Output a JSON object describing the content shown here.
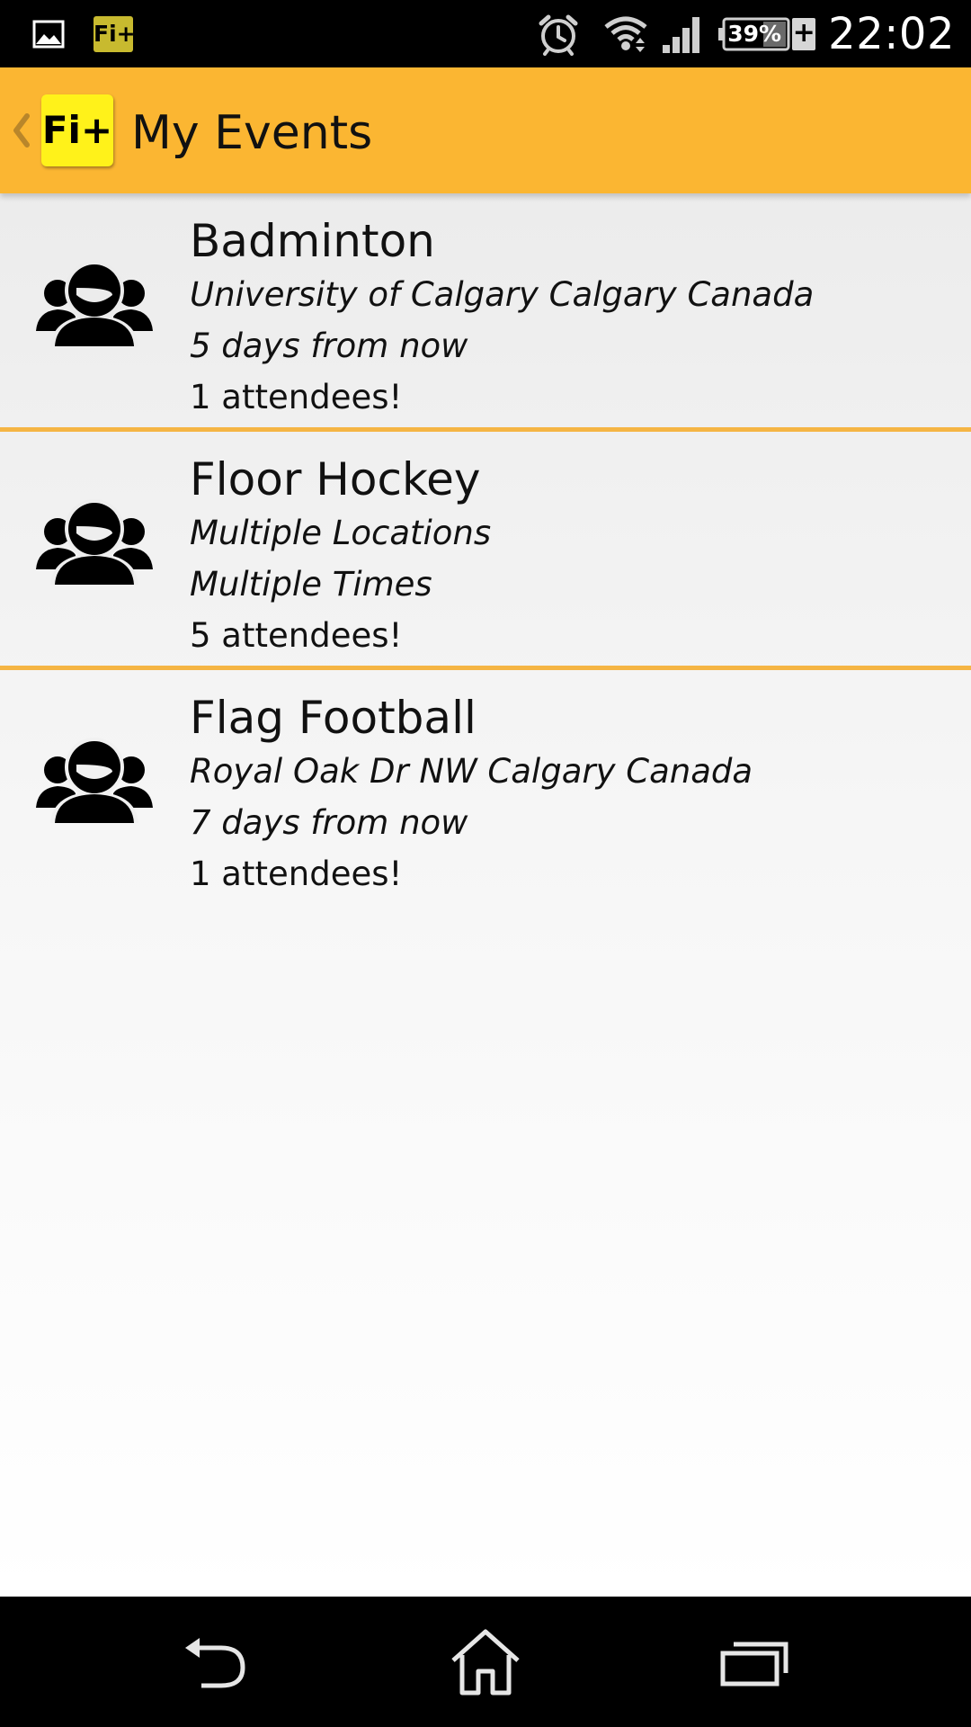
{
  "status_bar": {
    "notification_icons": [
      "gallery-icon",
      "fi-plus-app-icon"
    ],
    "app_badge_text": "Fi+",
    "system_icons": [
      "alarm-icon",
      "wifi-icon",
      "signal-icon",
      "battery-icon",
      "charging-icon"
    ],
    "battery_text": "39%",
    "charging_symbol": "+",
    "time": "22:02"
  },
  "action_bar": {
    "up_icon": "chevron-left-icon",
    "logo_text": "Fi+",
    "title": "My Events",
    "background": "#fbb632"
  },
  "events": [
    {
      "icon": "group-icon",
      "name": "Badminton",
      "location": "University of Calgary Calgary Canada",
      "time": "5 days from now",
      "attendees": "1 attendees!"
    },
    {
      "icon": "group-icon",
      "name": "Floor Hockey",
      "location": "Multiple Locations",
      "time": "Multiple Times",
      "attendees": "5 attendees!"
    },
    {
      "icon": "group-icon",
      "name": "Flag Football",
      "location": "Royal Oak Dr NW Calgary Canada",
      "time": "7 days from now",
      "attendees": "1 attendees!"
    }
  ],
  "colors": {
    "accent": "#fbb632",
    "divider": "#f5b544",
    "logo": "#fff21a"
  },
  "nav_bar": {
    "buttons": [
      "back-icon",
      "home-icon",
      "recent-apps-icon"
    ]
  }
}
